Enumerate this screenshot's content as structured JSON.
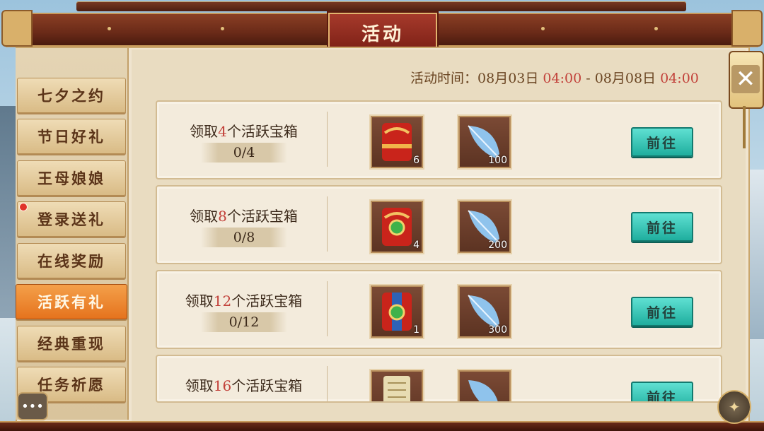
{
  "header": {
    "title": "活动"
  },
  "sidebar": {
    "tabs": [
      {
        "label": "七夕之约",
        "active": false,
        "badge": false
      },
      {
        "label": "节日好礼",
        "active": false,
        "badge": false
      },
      {
        "label": "王母娘娘",
        "active": false,
        "badge": false
      },
      {
        "label": "登录送礼",
        "active": false,
        "badge": true
      },
      {
        "label": "在线奖励",
        "active": false,
        "badge": false
      },
      {
        "label": "活跃有礼",
        "active": true,
        "badge": false
      },
      {
        "label": "经典重现",
        "active": false,
        "badge": false
      },
      {
        "label": "任务祈愿",
        "active": false,
        "badge": false
      }
    ]
  },
  "event_time": {
    "label": "活动时间：",
    "start_date": "08月03日",
    "start_time": "04:00",
    "separator": "-",
    "end_date": "08月08日",
    "end_time": "04:00"
  },
  "rows": [
    {
      "prefix": "领取",
      "count": "4",
      "suffix": "个活跃宝箱",
      "progress": "0/4",
      "rewards": [
        {
          "icon": "red-gift-pouch-icon",
          "qty": "6"
        },
        {
          "icon": "blue-feather-icon",
          "qty": "100"
        }
      ],
      "button": "前往"
    },
    {
      "prefix": "领取",
      "count": "8",
      "suffix": "个活跃宝箱",
      "progress": "0/8",
      "rewards": [
        {
          "icon": "jade-gift-pouch-icon",
          "qty": "4"
        },
        {
          "icon": "blue-feather-icon",
          "qty": "200"
        }
      ],
      "button": "前往"
    },
    {
      "prefix": "领取",
      "count": "12",
      "suffix": "个活跃宝箱",
      "progress": "0/12",
      "rewards": [
        {
          "icon": "blue-gift-pouch-icon",
          "qty": "1"
        },
        {
          "icon": "blue-feather-icon",
          "qty": "300"
        }
      ],
      "button": "前往"
    },
    {
      "prefix": "领取",
      "count": "16",
      "suffix": "个活跃宝箱",
      "progress": "",
      "rewards": [
        {
          "icon": "scroll-pouch-icon",
          "qty": ""
        },
        {
          "icon": "blue-feather-icon",
          "qty": ""
        }
      ],
      "button": "前往"
    }
  ],
  "controls": {
    "close": "✕",
    "chat": "•••"
  },
  "colors": {
    "highlight_red": "#c2413a",
    "active_tab": "#e5731d",
    "go_button": "#1fae9e"
  }
}
